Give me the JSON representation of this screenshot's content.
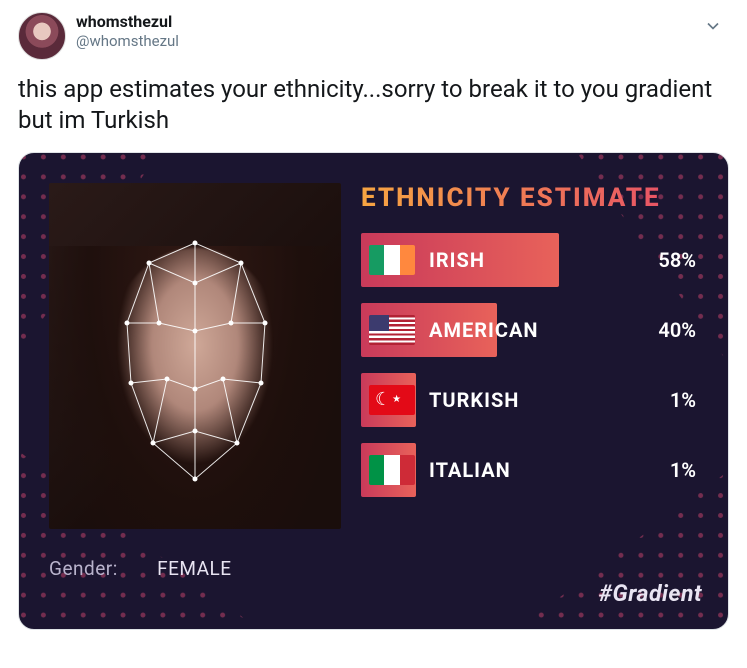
{
  "tweet": {
    "display_name": "whomsthezul",
    "handle": "@whomsthezul",
    "body": "this app estimates your ethnicity...sorry to break it to you gradient but im Turkish"
  },
  "card": {
    "title": "ETHNICITY ESTIMATE",
    "gender_label": "Gender:",
    "gender_value": "FEMALE",
    "hashtag": "#Gradient",
    "colors": {
      "bg": "#1b1530",
      "bar_from": "#c93a5a",
      "bar_to": "#e8625a",
      "title_from": "#f7a542",
      "title_to": "#e64a6a"
    },
    "rows": [
      {
        "flag": "ie",
        "label": "IRISH",
        "pct": 58,
        "display": "58%"
      },
      {
        "flag": "us",
        "label": "AMERICAN",
        "pct": 40,
        "display": "40%"
      },
      {
        "flag": "tr",
        "label": "TURKISH",
        "pct": 1,
        "display": "1%"
      },
      {
        "flag": "it",
        "label": "ITALIAN",
        "pct": 1,
        "display": "1%"
      }
    ]
  },
  "icons": {
    "chevron": "chevron-down-icon"
  }
}
